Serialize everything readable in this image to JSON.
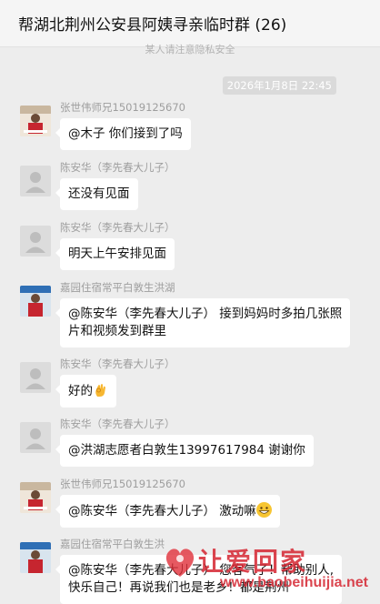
{
  "window": {
    "title": "帮湖北荆州公安县阿姨寻亲临时群 (26)"
  },
  "notice": "某人请注意隐私安全",
  "timestamp": "2026年1月8日 22:45",
  "messages": [
    {
      "sender": "张世伟师兄15019125670",
      "avatar": "photo",
      "text": "@木子 你们接到了吗"
    },
    {
      "sender": "陈安华（李先春大儿子）",
      "avatar": "default",
      "text": "还没有见面"
    },
    {
      "sender": "陈安华（李先春大儿子）",
      "avatar": "default",
      "text": "明天上午安排见面"
    },
    {
      "sender": "嘉园住宿常平白敦生洪湖",
      "avatar": "photo",
      "text_line1": "@陈安华（李先春大儿子） 接到妈妈时多拍几张照",
      "text_line2": "片和视频发到群里"
    },
    {
      "sender": "陈安华（李先春大儿子）",
      "avatar": "default",
      "text": "好的",
      "emoji": "ok-hand-emoji"
    },
    {
      "sender": "陈安华（李先春大儿子）",
      "avatar": "default",
      "text": "@洪湖志愿者白敦生13997617984 谢谢你"
    },
    {
      "sender": "张世伟师兄15019125670",
      "avatar": "photo",
      "text": "@陈安华（李先春大儿子） 激动嘛",
      "emoji": "grinning-emoji"
    },
    {
      "sender": "嘉园住宿常平白敦生洪",
      "avatar": "photo",
      "text_line1": "@陈安华（李先春大儿子） 您客气了！帮助别人,",
      "text_line2": "快乐自己！再说我们也是老乡！都是荆州"
    }
  ],
  "watermark": {
    "text": "让爱回家",
    "url": "www.baobeihuijia.net"
  },
  "colors": {
    "watermark": "#d52531",
    "bubble": "#ffffff",
    "background": "#ededed"
  }
}
